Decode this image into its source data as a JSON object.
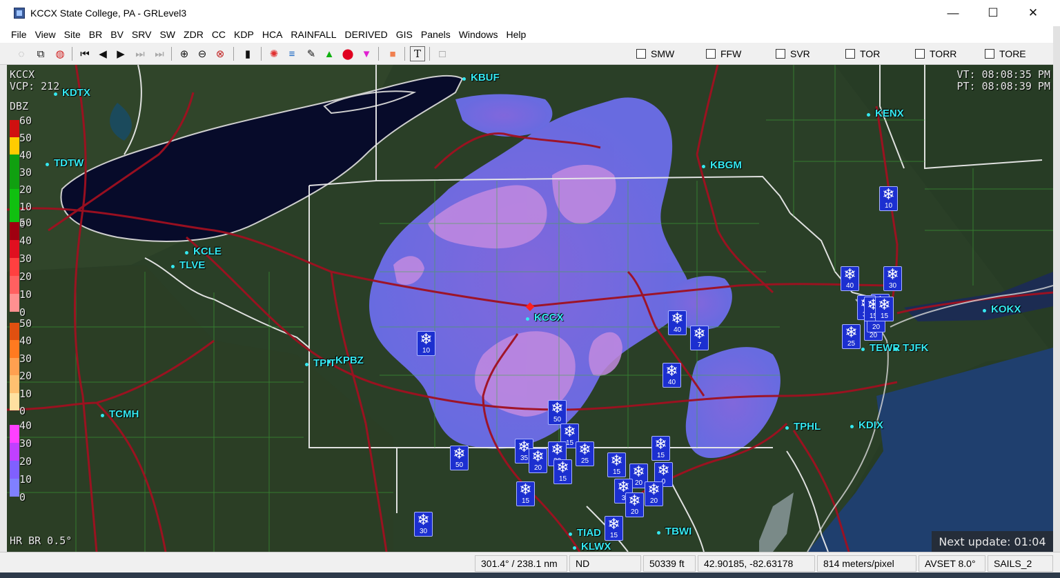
{
  "window": {
    "title": "KCCX State College, PA - GRLevel3",
    "minimize_glyph": "—",
    "maximize_glyph": "☐",
    "close_glyph": "✕"
  },
  "menu": [
    "File",
    "View",
    "Site",
    "BR",
    "BV",
    "SRV",
    "SW",
    "ZDR",
    "CC",
    "KDP",
    "HCA",
    "RAINFALL",
    "DERIVED",
    "GIS",
    "Panels",
    "Windows",
    "Help"
  ],
  "toolbar": {
    "buttons": [
      {
        "name": "refresh-icon",
        "glyph": "◌"
      },
      {
        "name": "copy-icon",
        "glyph": "⧉"
      },
      {
        "name": "globe-icon",
        "glyph": "◍"
      },
      {
        "name": "first-frame-icon",
        "glyph": "⏮"
      },
      {
        "name": "prev-frame-icon",
        "glyph": "◀"
      },
      {
        "name": "play-icon",
        "glyph": "▶"
      },
      {
        "name": "next-frame-icon",
        "glyph": "⏭"
      },
      {
        "name": "last-frame-icon",
        "glyph": "⏭"
      },
      {
        "name": "zoom-in-icon",
        "glyph": "⊕"
      },
      {
        "name": "zoom-out-icon",
        "glyph": "⊖"
      },
      {
        "name": "zoom-reset-icon",
        "glyph": "⊗"
      },
      {
        "name": "color-table-icon",
        "glyph": "▮"
      },
      {
        "name": "storm-icon",
        "glyph": "✺"
      },
      {
        "name": "layers-icon",
        "glyph": "≡"
      },
      {
        "name": "measure-icon",
        "glyph": "✎"
      },
      {
        "name": "triangle-icon",
        "glyph": "▲"
      },
      {
        "name": "circle-icon",
        "glyph": "⬤"
      },
      {
        "name": "inverted-triangle-icon",
        "glyph": "▼"
      },
      {
        "name": "orange-square-icon",
        "glyph": "■"
      },
      {
        "name": "text-icon",
        "glyph": "T"
      },
      {
        "name": "blank-square-icon",
        "glyph": "□"
      }
    ],
    "checkboxes": [
      "SMW",
      "FFW",
      "SVR",
      "TOR",
      "TORR",
      "TORE"
    ]
  },
  "overlay": {
    "site_code": "KCCX",
    "vcp": "VCP: 212",
    "vt": "VT: 08:08:35 PM",
    "pt": "PT: 08:08:39 PM",
    "product": "HR BR 0.5°",
    "next_update": "Next update: 01:04",
    "legend_title": "DBZ",
    "legend_groups": [
      {
        "labels": [
          "60",
          "50",
          "40",
          "30",
          "20",
          "10",
          "0"
        ],
        "colors": [
          "#d01010",
          "#ffcc00",
          "#10a010",
          "#10a010",
          "#10c010",
          "#10c010"
        ]
      },
      {
        "labels": [
          "50",
          "40",
          "30",
          "20",
          "10",
          "0"
        ],
        "colors": [
          "#a00010",
          "#e01020",
          "#ff4040",
          "#ff6060",
          "#ff9090"
        ]
      },
      {
        "labels": [
          "50",
          "40",
          "30",
          "20",
          "10",
          "0"
        ],
        "colors": [
          "#e05010",
          "#ff7a20",
          "#ffa050",
          "#ffc070",
          "#ffe0a0"
        ]
      },
      {
        "labels": [
          "40",
          "30",
          "20",
          "10",
          "0"
        ],
        "colors": [
          "#ff40ff",
          "#c040ff",
          "#8060ff",
          "#8080ff"
        ]
      }
    ]
  },
  "sites": [
    {
      "label": "KDTX"
    },
    {
      "label": "TDTW"
    },
    {
      "label": "KBUF"
    },
    {
      "label": "KENX"
    },
    {
      "label": "KBGM"
    },
    {
      "label": "KCLE"
    },
    {
      "label": "TLVE"
    },
    {
      "label": "KCCX"
    },
    {
      "label": "TPIT"
    },
    {
      "label": "KPBZ"
    },
    {
      "label": "TCMH"
    },
    {
      "label": "KOKX"
    },
    {
      "label": "TEWR"
    },
    {
      "label": "TJFK"
    },
    {
      "label": "TPHL"
    },
    {
      "label": "KDIX"
    },
    {
      "label": "TIAD"
    },
    {
      "label": "KLWX"
    },
    {
      "label": "TBWI"
    }
  ],
  "snow_reports": [
    "10",
    "10",
    "40",
    "30",
    "40",
    "30",
    "30",
    "20",
    "25",
    "7",
    "40",
    "20",
    "50",
    "35",
    "15",
    "20",
    "20",
    "15",
    "25",
    "15",
    "15",
    "50",
    "15",
    "20",
    "0",
    "3",
    "20",
    "20",
    "15",
    "30",
    "15",
    "15"
  ],
  "statusbar": {
    "azimuth": "301.4° / 238.1 nm",
    "value": "ND",
    "height": "50339 ft",
    "latlon": "42.90185, -82.63178",
    "scale": "814 meters/pixel",
    "avset": "AVSET 8.0°",
    "sails": "SAILS_2"
  }
}
